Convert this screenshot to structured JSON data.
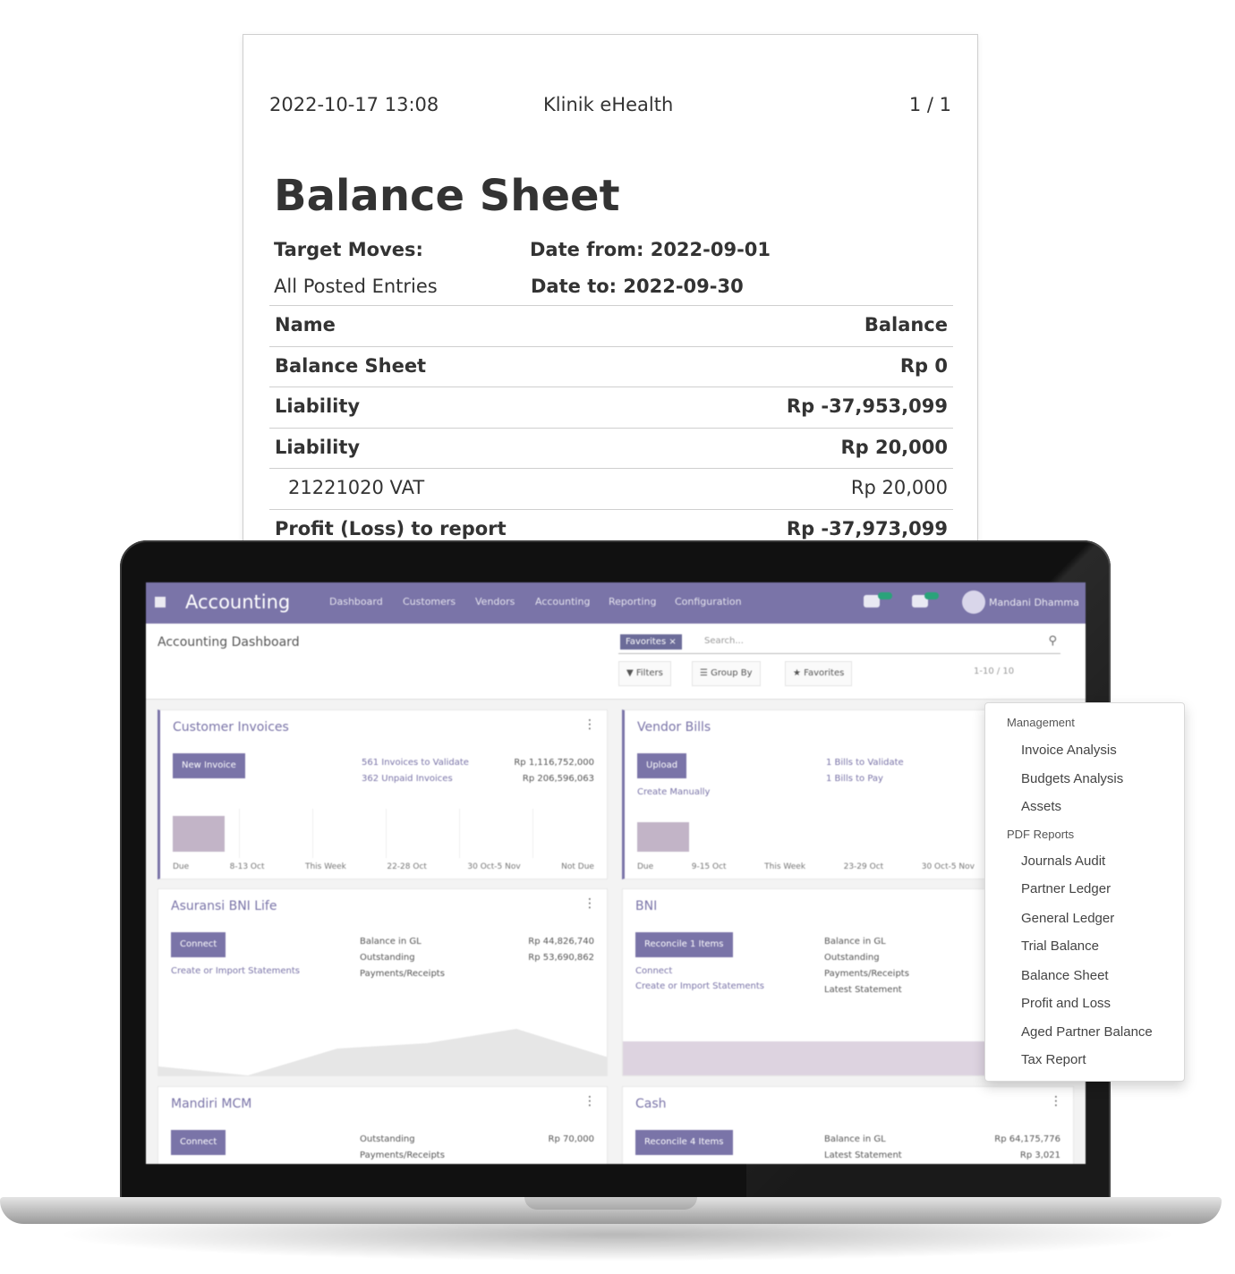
{
  "report": {
    "header_date": "2022-10-17 13:08",
    "header_company": "Klinik eHealth",
    "header_page": "1 / 1",
    "title": "Balance Sheet",
    "target_moves_label": "Target Moves:",
    "target_moves_value": "All Posted Entries",
    "date_from": "Date from: 2022-09-01",
    "date_to": "Date to: 2022-09-30",
    "col_name": "Name",
    "col_balance": "Balance",
    "rows": [
      {
        "name": "Balance Sheet",
        "balance": "Rp 0"
      },
      {
        "name": "Liability",
        "balance": "Rp -37,953,099"
      },
      {
        "name": "Liability",
        "balance": "Rp 20,000"
      },
      {
        "name": "21221020 VAT",
        "balance": "Rp 20,000"
      },
      {
        "name": "Profit (Loss) to report",
        "balance": "Rp -37,973,099"
      }
    ]
  },
  "app": {
    "name": "Accounting",
    "nav": [
      "Dashboard",
      "Customers",
      "Vendors",
      "Accounting",
      "Reporting",
      "Configuration"
    ],
    "badge1": "",
    "badge2": "",
    "user": "Mandani Dhamma",
    "breadcrumb": "Accounting Dashboard",
    "search_facet": "Favorites ×",
    "search_placeholder": "Search...",
    "filters_label": "Filters",
    "group_by_label": "Group By",
    "favorites_label": "Favorites",
    "pager": "1-10 / 10"
  },
  "dashboard": {
    "customer_invoices": {
      "title": "Customer Invoices",
      "button": "New Invoice",
      "links": [
        "561 Invoices to Validate",
        "362 Unpaid Invoices"
      ],
      "amounts": [
        "Rp 1,116,752,000",
        "Rp 206,596,063"
      ],
      "axis": [
        "Due",
        "8-13 Oct",
        "This Week",
        "22-28 Oct",
        "30 Oct-5 Nov",
        "Not Due"
      ]
    },
    "vendor_bills": {
      "title": "Vendor Bills",
      "button": "Upload",
      "sub": "Create Manually",
      "links": [
        "1 Bills to Validate",
        "1 Bills to Pay"
      ],
      "axis": [
        "Due",
        "9-15 Oct",
        "This Week",
        "23-29 Oct",
        "30 Oct-5 Nov"
      ]
    },
    "bank1": {
      "title": "Asuransi BNI Life",
      "button": "Connect",
      "sub": "Create or Import Statements",
      "labels": [
        "Balance in GL",
        "Outstanding",
        "Payments/Receipts"
      ],
      "amounts": [
        "Rp 44,826,740",
        "Rp 53,690,862"
      ]
    },
    "bank2": {
      "title": "BNI",
      "button": "Reconcile 1 Items",
      "sub": "Connect",
      "sub2": "Create or Import Statements",
      "labels": [
        "Balance in GL",
        "Outstanding",
        "Payments/Receipts",
        "Latest Statement"
      ]
    },
    "bank3": {
      "title": "Mandiri MCM",
      "button": "Connect",
      "labels": [
        "Outstanding",
        "Payments/Receipts"
      ],
      "amounts": [
        "Rp 70,000"
      ]
    },
    "cash": {
      "title": "Cash",
      "button": "Reconcile 4 Items",
      "labels": [
        "Balance in GL",
        "Latest Statement"
      ],
      "amounts": [
        "Rp 64,175,776",
        "Rp 3,021"
      ]
    }
  },
  "dropdown": {
    "section1": "Management",
    "management_items": [
      "Invoice Analysis",
      "Budgets Analysis",
      "Assets"
    ],
    "section2": "PDF Reports",
    "pdf_items": [
      "Journals Audit",
      "Partner Ledger",
      "General Ledger",
      "Trial Balance",
      "Balance Sheet",
      "Profit and Loss",
      "Aged Partner Balance",
      "Tax Report"
    ]
  },
  "colors": {
    "brand": "#7a74a8",
    "chart_bar": "#c2b4c7"
  }
}
